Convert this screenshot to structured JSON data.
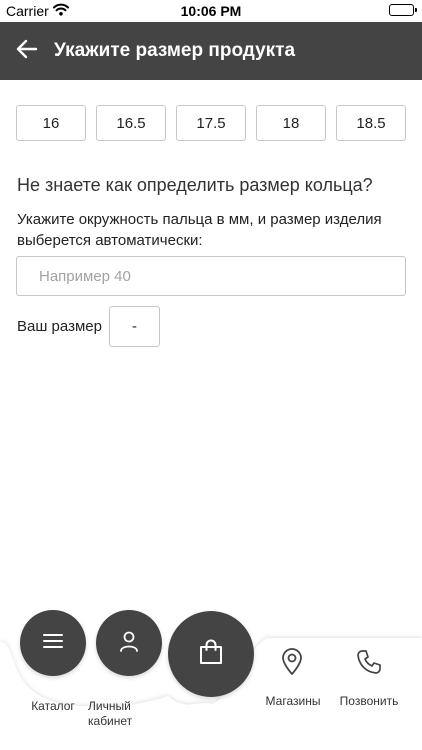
{
  "status_bar": {
    "carrier": "Carrier",
    "time": "10:06 PM"
  },
  "header": {
    "title": "Укажите размер продукта"
  },
  "sizes": [
    "16",
    "16.5",
    "17.5",
    "18",
    "18.5"
  ],
  "help": {
    "title": "Не знаете как определить размер кольца?",
    "text": "Укажите окружность пальца в мм, и размер изделия выберется автоматически:"
  },
  "circumference": {
    "placeholder": "Например 40",
    "value": ""
  },
  "result": {
    "label": "Ваш размер",
    "value": "-"
  },
  "nav": {
    "catalog": "Каталог",
    "account": "Личный кабинет",
    "stores": "Магазины",
    "call": "Позвонить"
  },
  "colors": {
    "header_bg": "#444444",
    "button_bg": "#444444",
    "border": "#c7c7c7"
  }
}
